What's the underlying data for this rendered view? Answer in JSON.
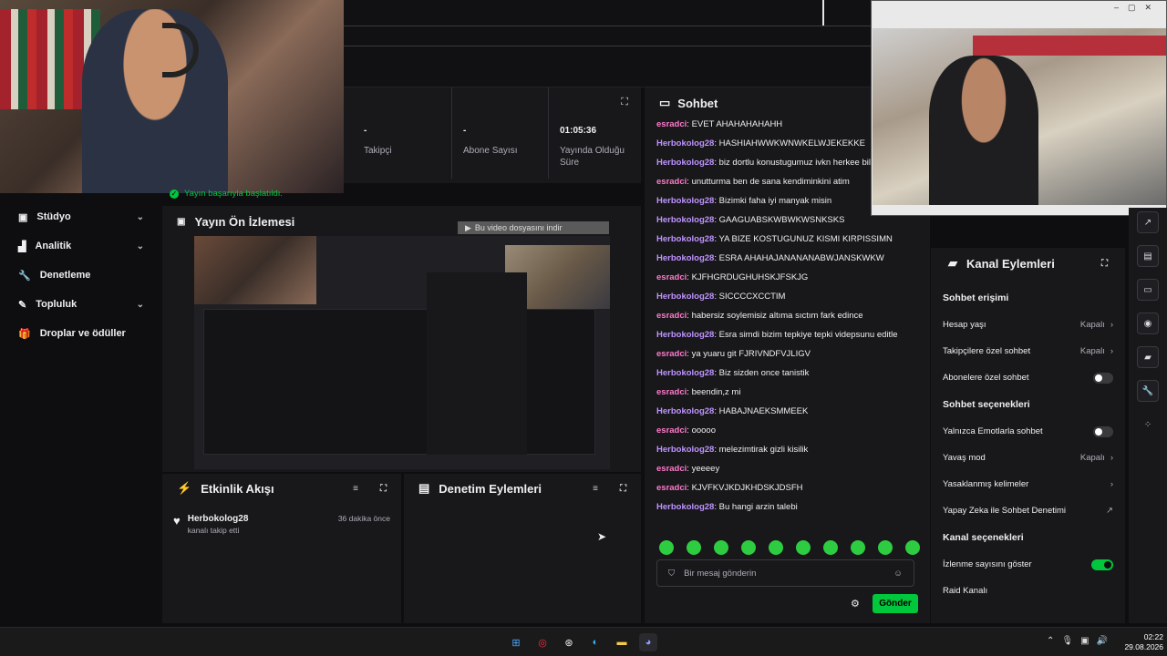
{
  "sidebar": {
    "items": [
      {
        "label": "Stüdyo",
        "icon": "studio-icon",
        "expand": true
      },
      {
        "label": "Analitik",
        "icon": "analytics-icon",
        "expand": true
      },
      {
        "label": "Denetleme",
        "icon": "wrench-icon",
        "expand": false
      },
      {
        "label": "Topluluk",
        "icon": "community-icon",
        "expand": true
      },
      {
        "label": "Droplar ve ödüller",
        "icon": "gift-icon",
        "expand": false
      }
    ]
  },
  "stats": [
    {
      "value": "-",
      "label": "Takipçi"
    },
    {
      "value": "-",
      "label": "Abone Sayısı"
    },
    {
      "value": "01:05:36",
      "label": "Yayında Olduğu Süre"
    }
  ],
  "toast": "Yayın başarıyla başlatıldı.",
  "preview": {
    "title": "Yayın Ön İzlemesi",
    "overlay": "Bu video dosyasını indir"
  },
  "activity": {
    "title": "Etkinlik Akışı",
    "user": "Herbokolog28",
    "action": "kanalı takip etti",
    "time": "36 dakika önce"
  },
  "moderation": {
    "title": "Denetim Eylemleri"
  },
  "chat": {
    "title": "Sohbet",
    "messages": [
      {
        "user": "esradci",
        "text": "EVET AHAHAHAHAHH",
        "c": "e"
      },
      {
        "user": "Herbokolog28",
        "text": "HASHIAHWWKWNWKELWJEKEKKE",
        "c": "h"
      },
      {
        "user": "Herbokolog28",
        "text": "biz dortlu konustugumuz ivkn herkee biliyor",
        "c": "h"
      },
      {
        "user": "esradci",
        "text": "unutturma ben de sana kendiminkini atim",
        "c": "e"
      },
      {
        "user": "Herbokolog28",
        "text": "Bizimki faha iyi manyak misin",
        "c": "h"
      },
      {
        "user": "Herbokolog28",
        "text": "GAAGUABSKWBWKWSNKSKS",
        "c": "h"
      },
      {
        "user": "Herbokolog28",
        "text": "YA BIZE KOSTUGUNUZ KISMI KIRPISSIMN",
        "c": "h"
      },
      {
        "user": "Herbokolog28",
        "text": "ESRA AHAHAJANANANABWJANSKWKW",
        "c": "h"
      },
      {
        "user": "esradci",
        "text": "KJFHGRDUGHUHSKJFSKJG",
        "c": "e"
      },
      {
        "user": "Herbokolog28",
        "text": "SICCCCXCCTIM",
        "c": "h"
      },
      {
        "user": "esradci",
        "text": "habersiz soylemisiz altıma sıctım fark edince",
        "c": "e"
      },
      {
        "user": "Herbokolog28",
        "text": "Esra simdi bizim tepkiye tepki videpsunu editle",
        "c": "h"
      },
      {
        "user": "esradci",
        "text": "ya yuaru git FJRIVNDFVJLIGV",
        "c": "e"
      },
      {
        "user": "Herbokolog28",
        "text": "Biz sizden once tanistik",
        "c": "h"
      },
      {
        "user": "esradci",
        "text": "beendin,z mi",
        "c": "e"
      },
      {
        "user": "Herbokolog28",
        "text": "HABAJNAEKSMMEEK",
        "c": "h"
      },
      {
        "user": "esradci",
        "text": "ooooo",
        "c": "e"
      },
      {
        "user": "Herbokolog28",
        "text": "melezimtirak gizli kisilik",
        "c": "h"
      },
      {
        "user": "esradci",
        "text": "yeeeey",
        "c": "e"
      },
      {
        "user": "esradci",
        "text": "KJVFKVJKDJKHDSKJDSFH",
        "c": "e"
      },
      {
        "user": "Herbokolog28",
        "text": "Bu hangi arzin talebi",
        "c": "h"
      }
    ],
    "placeholder": "Bir mesaj gönderin",
    "send": "Gönder"
  },
  "channel": {
    "title": "Kanal Eylemleri",
    "sections": {
      "access": "Sohbet erişimi",
      "options": "Sohbet seçenekleri",
      "channel": "Kanal seçenekleri"
    },
    "account_age": {
      "label": "Hesap yaşı",
      "value": "Kapalı"
    },
    "followers_only": {
      "label": "Takipçilere özel sohbet",
      "value": "Kapalı"
    },
    "subs_only": {
      "label": "Abonelere özel sohbet"
    },
    "emotes_only": {
      "label": "Yalnızca Emotlarla sohbet"
    },
    "slow_mode": {
      "label": "Yavaş mod",
      "value": "Kapalı"
    },
    "banned_words": {
      "label": "Yasaklanmış kelimeler"
    },
    "ai_mod": {
      "label": "Yapay Zeka ile Sohbet Denetimi"
    },
    "viewer_count": {
      "label": "İzlenme sayısını göster"
    },
    "raid": {
      "label": "Raid Kanalı"
    }
  },
  "taskbar": {
    "time": "02:22",
    "date": "29.08.2026"
  },
  "colors": {
    "accent": "#00c73c",
    "user_a": "#bf94ff",
    "user_b": "#ff7acb"
  }
}
